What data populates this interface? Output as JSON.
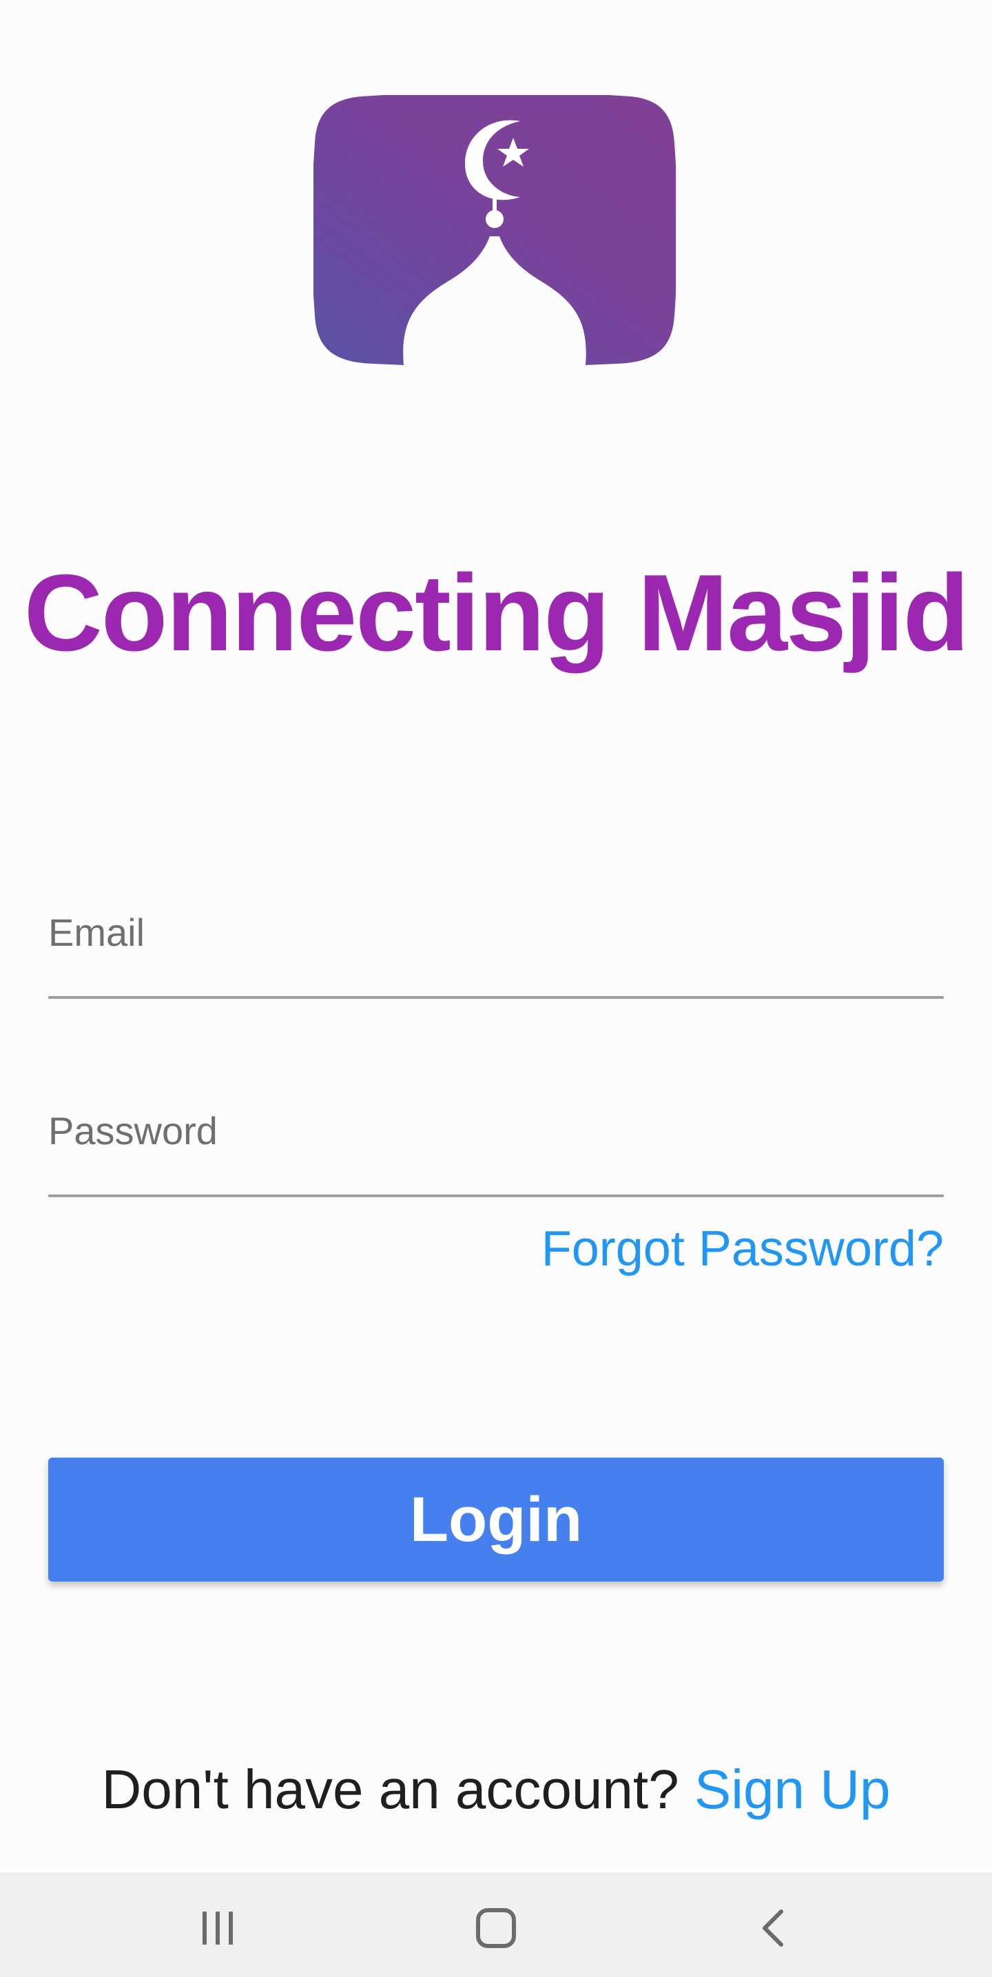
{
  "app": {
    "title": "Connecting Masjid",
    "logo_icon": "mosque-dome-crescent-star-icon",
    "brand_colors": {
      "title": "#9c27b0",
      "logo_gradient_start": "#5a52a5",
      "logo_gradient_end": "#7e3f97",
      "link": "#2196f3",
      "button": "#4680ee"
    }
  },
  "form": {
    "email_placeholder": "Email",
    "email_value": "",
    "password_placeholder": "Password",
    "password_value": "",
    "forgot_password_label": "Forgot Password?",
    "login_label": "Login"
  },
  "signup": {
    "prompt": "Don't have an account?",
    "link_label": "Sign Up"
  },
  "navbar": {
    "recents_icon": "recents-icon",
    "home_icon": "home-icon",
    "back_icon": "back-icon"
  }
}
